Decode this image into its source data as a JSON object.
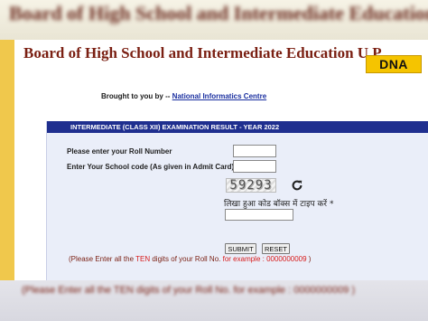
{
  "banner": {
    "blurred_title": "Board of High School and Intermediate Education U.P."
  },
  "header": {
    "board_title": "Board of High School and Intermediate Education U.P.",
    "logo_text": "DNA"
  },
  "credits": {
    "brought_text": "Brought to you by --",
    "link_text": "National Informatics Centre"
  },
  "form": {
    "header": "INTERMEDIATE (CLASS XII)  EXAMINATION RESULT - YEAR 2022",
    "roll_label": "Please enter your Roll Number",
    "school_label": "Enter Your School code (As given in Admit Card)",
    "roll_value": "",
    "school_value": "",
    "captcha_text": "59293",
    "captcha_prompt": "लिखा हुआ कोड बॉक्स में टाइप करें *",
    "captcha_value": "",
    "submit_label": "SUBMIT",
    "reset_label": "RESET"
  },
  "note": {
    "prefix": "(Please Enter all the ",
    "highlight_ten": "TEN",
    "middle": " digits of your Roll No. ",
    "example": "for example : 0000000009",
    "suffix": " )"
  },
  "footer_blur": {
    "text": "(Please Enter all the TEN digits of your Roll No. for example : 0000000009 )"
  },
  "colors": {
    "title_maroon": "#7a1f12",
    "header_blue": "#1f2f8f",
    "form_bg": "#eaeef9",
    "side_yellow": "#f0c84c",
    "logo_yellow": "#f5c400"
  },
  "icons": {
    "refresh": "refresh-icon"
  }
}
